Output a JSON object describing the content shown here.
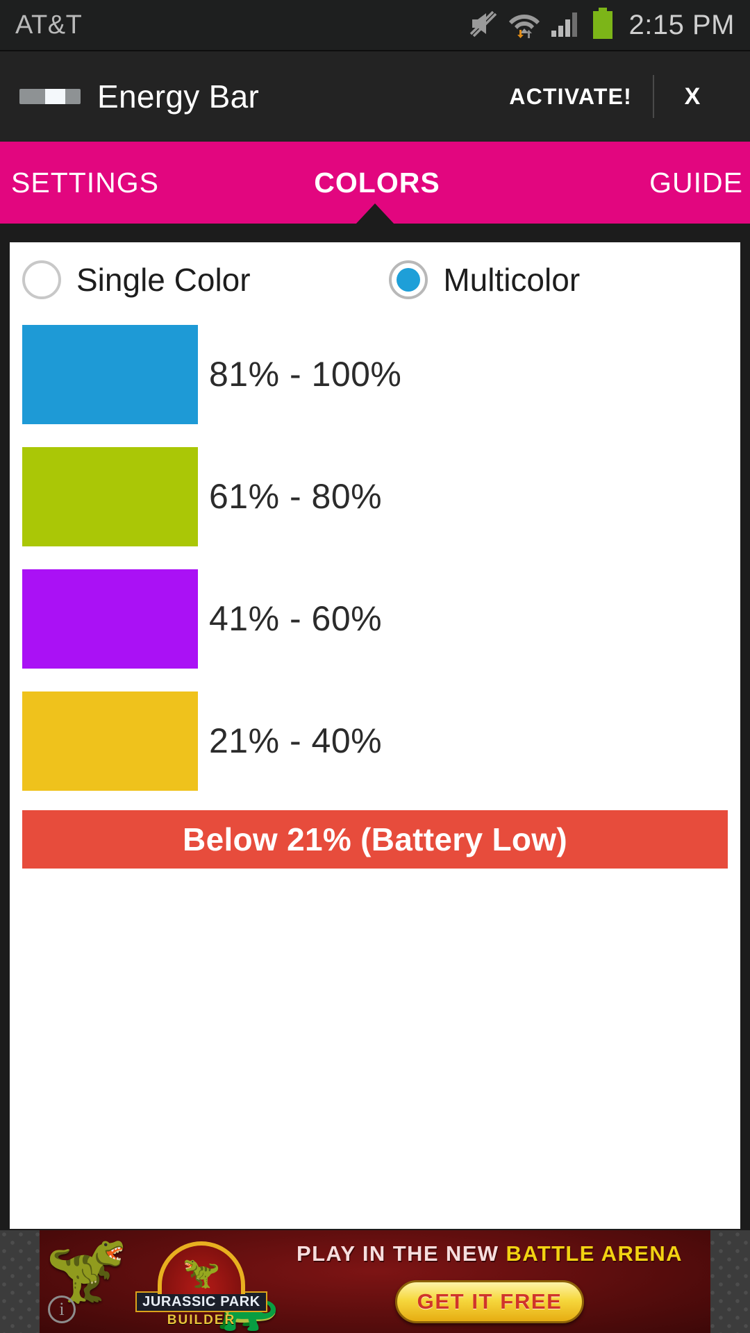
{
  "status_bar": {
    "carrier": "AT&T",
    "time": "2:15 PM",
    "icons": [
      "mute-icon",
      "wifi-icon",
      "signal-icon",
      "battery-icon"
    ],
    "battery_color": "#7cb518"
  },
  "action_bar": {
    "app_title": "Energy Bar",
    "app_icon": "energy-bar-icon",
    "activate_label": "ACTIVATE!",
    "close_label": "X"
  },
  "tabs": {
    "accent_color": "#e2067f",
    "items": [
      {
        "label": "SETTINGS",
        "active": false
      },
      {
        "label": "COLORS",
        "active": true
      },
      {
        "label": "GUIDE",
        "active": false
      }
    ]
  },
  "color_mode": {
    "options": [
      {
        "label": "Single Color",
        "selected": false
      },
      {
        "label": "Multicolor",
        "selected": true
      }
    ],
    "selected_accent": "#1e9fd8"
  },
  "color_ranges": [
    {
      "label": "81% - 100%",
      "color": "#1e9ad6"
    },
    {
      "label": "61% - 80%",
      "color": "#aac706"
    },
    {
      "label": "41% - 60%",
      "color": "#aa11f5"
    },
    {
      "label": "21% - 40%",
      "color": "#efc21c"
    }
  ],
  "low_battery": {
    "label": "Below 21% (Battery Low)",
    "color": "#e74c3c"
  },
  "ad": {
    "headline_white": "PLAY IN THE NEW",
    "headline_yellow": "BATTLE ARENA",
    "logo_title": "JURASSIC PARK",
    "logo_subtitle": "BUILDER",
    "cta_label": "GET IT FREE",
    "info_glyph": "i"
  }
}
